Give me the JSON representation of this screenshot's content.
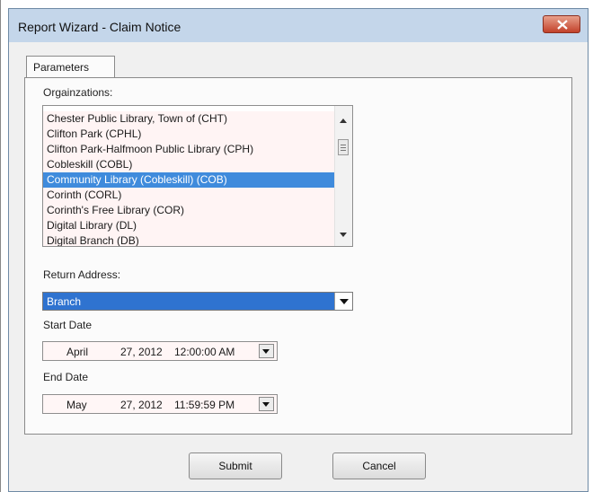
{
  "window": {
    "title": "Report Wizard - Claim Notice"
  },
  "tabs": [
    {
      "label": "Parameters"
    }
  ],
  "organizations": {
    "label": "Orgainzations:",
    "items": [
      {
        "label": "Chester Public Library, Town of (CHT)",
        "selected": false
      },
      {
        "label": "Clifton Park (CPHL)",
        "selected": false
      },
      {
        "label": "Clifton Park-Halfmoon Public Library (CPH)",
        "selected": false
      },
      {
        "label": "Cobleskill (COBL)",
        "selected": false
      },
      {
        "label": "Community Library (Cobleskill) (COB)",
        "selected": true
      },
      {
        "label": "Corinth (CORL)",
        "selected": false
      },
      {
        "label": "Corinth's Free Library (COR)",
        "selected": false
      },
      {
        "label": "Digital Library (DL)",
        "selected": false
      },
      {
        "label": "Digital Branch (DB)",
        "selected": false
      }
    ]
  },
  "return_address": {
    "label": "Return Address:",
    "value": "Branch"
  },
  "start_date": {
    "label": "Start Date",
    "month": "April",
    "day_year": "27, 2012",
    "time": "12:00:00 AM"
  },
  "end_date": {
    "label": "End Date",
    "month": "May",
    "day_year": "27, 2012",
    "time": "11:59:59 PM"
  },
  "buttons": {
    "submit": "Submit",
    "cancel": "Cancel"
  },
  "colors": {
    "selection": "#3f8bdc",
    "titlebar": "#c4d6ea",
    "close": "#c2412a"
  }
}
